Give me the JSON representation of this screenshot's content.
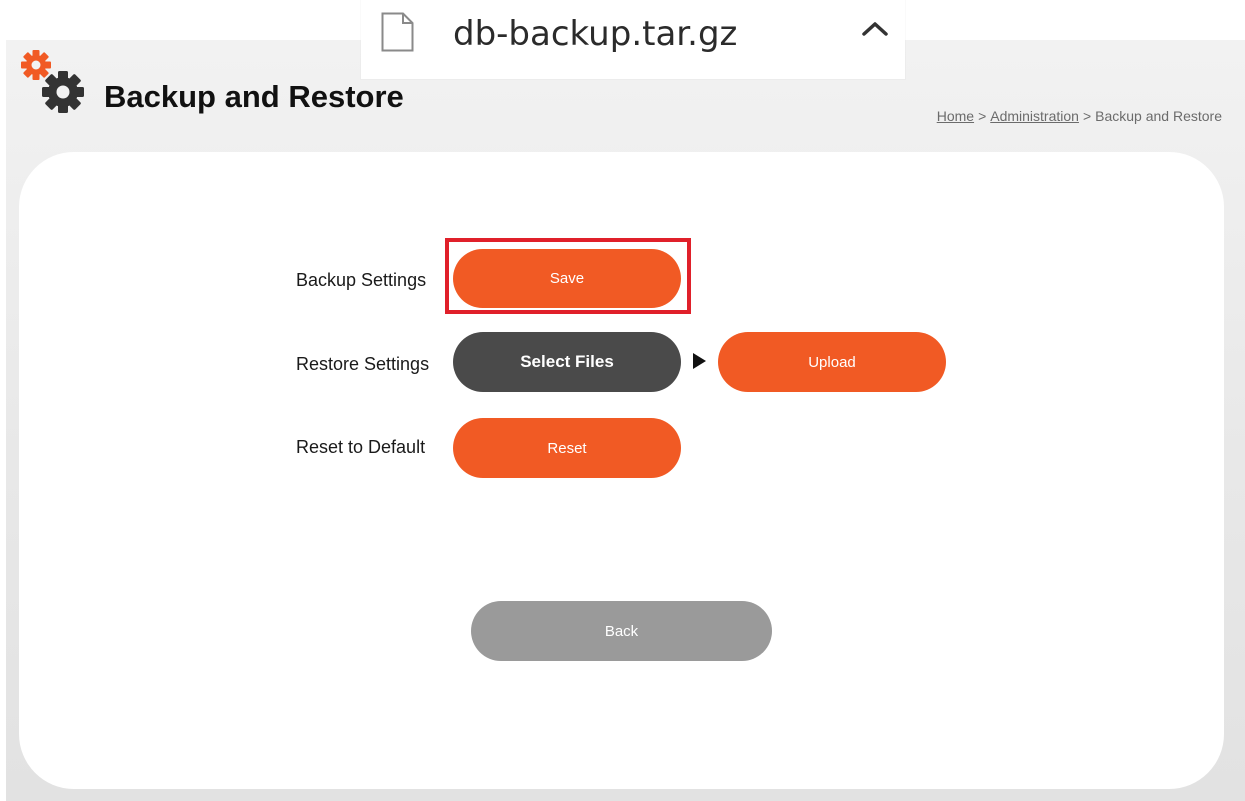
{
  "download": {
    "filename": "db-backup.tar.gz",
    "file_icon": "file-icon",
    "expand_icon": "chevron-up-icon"
  },
  "header": {
    "logo_icon": "gears-icon",
    "title": "Backup and Restore",
    "breadcrumb": {
      "home": "Home",
      "sep1": ">",
      "admin": "Administration",
      "sep2": ">",
      "current": "Backup and Restore"
    }
  },
  "settings": {
    "backup_label": "Backup Settings",
    "save_button": "Save",
    "restore_label": "Restore Settings",
    "select_files_button": "Select Files",
    "upload_button": "Upload",
    "reset_label": "Reset to Default",
    "reset_button": "Reset"
  },
  "footer": {
    "back_button": "Back"
  },
  "colors": {
    "accent_orange": "#f15a24",
    "dark_button": "#4a4a4a",
    "back_button": "#9a9a9a",
    "highlight": "#e0202a"
  }
}
